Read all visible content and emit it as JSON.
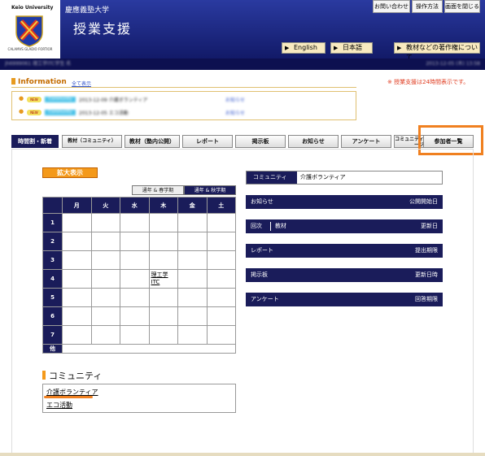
{
  "header": {
    "logo_text": "Keio University",
    "logo_motto": "CALAMVS GLADIO FORTIOR",
    "university": "慶應義塾大学",
    "title": "授業支援",
    "top_buttons": [
      "お問い合わせ",
      "操作方法",
      "画面を閉じる"
    ],
    "lang_english": "English",
    "lang_japanese": "日本語",
    "copyright_button": "教材などの著作権について"
  },
  "user_bar": {
    "user": "jh6999061 理工学ITC学生 名",
    "datetime": "2013-12-05 (木) 13:58"
  },
  "information": {
    "heading": "Information",
    "view_all": "全て表示",
    "notice": "※ 授業支援は24時間表示です。",
    "items": [
      {
        "badge": "NEW",
        "tag": "Community",
        "text": "2013-12-09 介護ボランティア",
        "link": "お知らせ"
      },
      {
        "badge": "NEW",
        "tag": "Community",
        "text": "2013-12-05 エコ活動",
        "link": "お知らせ"
      }
    ]
  },
  "tabs": [
    "時間割・新着",
    "教材（コミュニティ）",
    "教材（塾内公開）",
    "レポート",
    "掲示板",
    "お知らせ",
    "アンケート",
    "コミュニティ内メッセージ",
    "参加者一覧"
  ],
  "timetable": {
    "expand_button": "拡大表示",
    "semester_tabs": [
      "通年 & 春学期",
      "通年 & 秋学期"
    ],
    "days": [
      "月",
      "火",
      "水",
      "木",
      "金",
      "土"
    ],
    "periods": [
      "1",
      "2",
      "3",
      "4",
      "5",
      "6",
      "7"
    ],
    "other_label": "他",
    "class_cell": {
      "line1": "理工学",
      "line2": "ITC"
    }
  },
  "detail": {
    "community_label": "コミュニティ",
    "community_value": "介護ボランティア",
    "oshirase": {
      "left": "お知らせ",
      "right": "公開開始日"
    },
    "kyozai": {
      "col1": "回次",
      "col2": "教材",
      "right": "更新日"
    },
    "report": {
      "left": "レポート",
      "right": "提出期限"
    },
    "keijiban": {
      "left": "掲示板",
      "right": "更新日時"
    },
    "enquete": {
      "left": "アンケート",
      "right": "回答期限"
    }
  },
  "community": {
    "heading": "コミュニティ",
    "links": [
      "介護ボランティア",
      "エコ活動"
    ]
  },
  "colors": {
    "navy": "#1a1c5a",
    "highlight": "#f08020",
    "accent": "#f4991a"
  }
}
